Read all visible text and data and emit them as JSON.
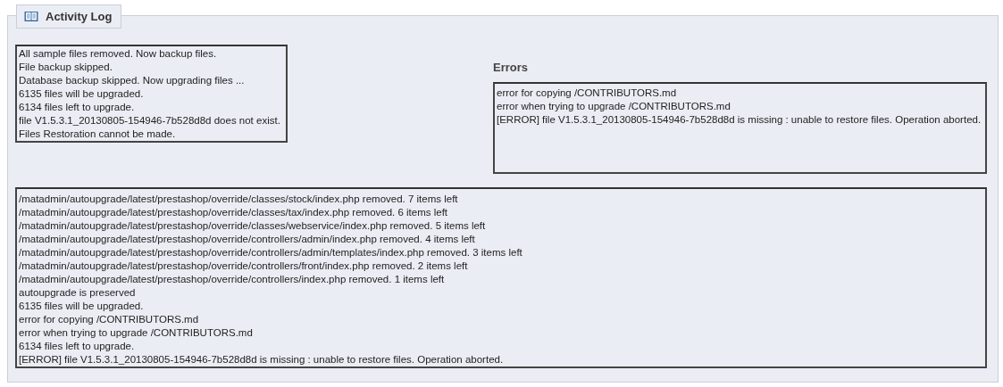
{
  "panel": {
    "title": "Activity Log"
  },
  "progress_log": [
    "All sample files removed. Now backup files.",
    "File backup skipped.",
    "Database backup skipped. Now upgrading files ...",
    "6135 files will be upgraded.",
    "6134 files left to upgrade.",
    "file V1.5.3.1_20130805-154946-7b528d8d does not exist. Files Restoration cannot be made."
  ],
  "errors": {
    "title": "Errors",
    "lines": [
      "error for copying /CONTRIBUTORS.md",
      "error when trying to upgrade /CONTRIBUTORS.md",
      "[ERROR] file V1.5.3.1_20130805-154946-7b528d8d is missing : unable to restore files. Operation aborted."
    ]
  },
  "detail_log": [
    "/matadmin/autoupgrade/latest/prestashop/override/classes/stock/index.php removed. 7 items left",
    "/matadmin/autoupgrade/latest/prestashop/override/classes/tax/index.php removed. 6 items left",
    "/matadmin/autoupgrade/latest/prestashop/override/classes/webservice/index.php removed. 5 items left",
    "/matadmin/autoupgrade/latest/prestashop/override/controllers/admin/index.php removed. 4 items left",
    "/matadmin/autoupgrade/latest/prestashop/override/controllers/admin/templates/index.php removed. 3 items left",
    "/matadmin/autoupgrade/latest/prestashop/override/controllers/front/index.php removed. 2 items left",
    "/matadmin/autoupgrade/latest/prestashop/override/controllers/index.php removed. 1 items left",
    "autoupgrade is preserved",
    "6135 files will be upgraded.",
    "error for copying /CONTRIBUTORS.md",
    "error when trying to upgrade /CONTRIBUTORS.md",
    "6134 files left to upgrade.",
    "[ERROR] file V1.5.3.1_20130805-154946-7b528d8d is missing : unable to restore files. Operation aborted."
  ]
}
